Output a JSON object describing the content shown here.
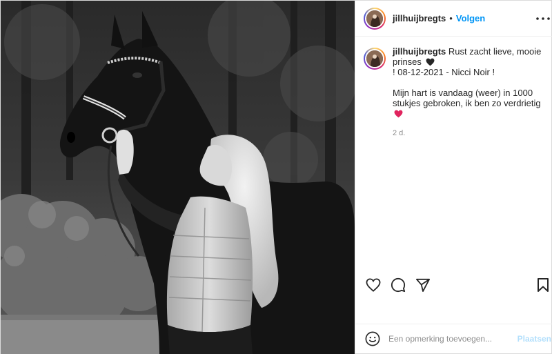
{
  "post": {
    "username": "jillhuijbregts",
    "separator": "•",
    "follow_label": "Volgen",
    "caption": {
      "username": "jillhuijbregts",
      "line1_text": "Rust zacht lieve, mooie prinses",
      "line2": "! 08-12-2021 - Nicci Noir !",
      "line3": "Mijn hart is vandaag (weer) in 1000 stukjes gebroken, ik ben zo verdrietig"
    },
    "timestamp": "2 d.",
    "comment_placeholder": "Een opmerking toevoegen...",
    "post_button_label": "Plaatsen"
  },
  "icons": {
    "like": "heart-icon",
    "comment": "comment-bubble-icon",
    "share": "paper-plane-icon",
    "save": "bookmark-icon",
    "emoji": "smiley-icon",
    "more": "more-dots-icon",
    "black_heart": "black-heart-emoji",
    "red_heart": "red-heart-emoji"
  },
  "colors": {
    "link_blue": "#0095f6",
    "post_disabled": "#b2dffc",
    "muted": "#8e8e8e",
    "red_heart": "#e0245e"
  }
}
